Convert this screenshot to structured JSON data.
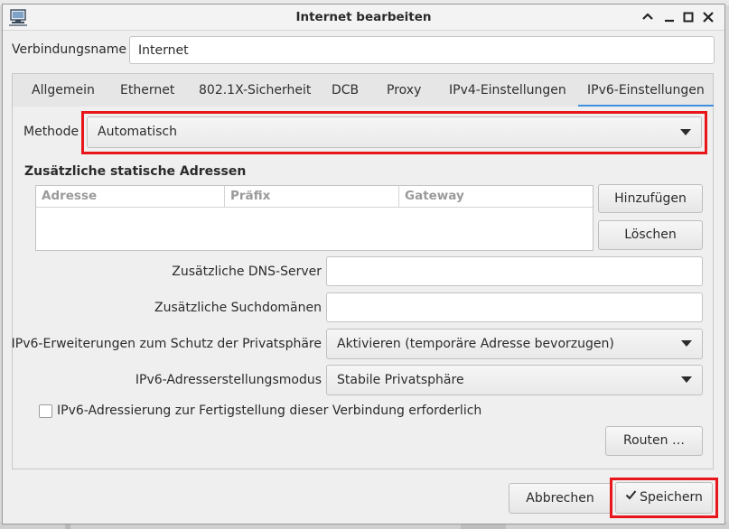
{
  "window": {
    "title": "Internet bearbeiten",
    "controls": [
      "chevron-up",
      "minimize",
      "maximize",
      "close"
    ]
  },
  "connection_name": {
    "label": "Verbindungsname",
    "value": "Internet"
  },
  "tabs": [
    {
      "label": "Allgemein",
      "active": false
    },
    {
      "label": "Ethernet",
      "active": false
    },
    {
      "label": "802.1X-Sicherheit",
      "active": false
    },
    {
      "label": "DCB",
      "active": false
    },
    {
      "label": "Proxy",
      "active": false
    },
    {
      "label": "IPv4-Einstellungen",
      "active": false
    },
    {
      "label": "IPv6-Einstellungen",
      "active": true
    }
  ],
  "ipv6": {
    "method": {
      "label": "Methode",
      "value": "Automatisch"
    },
    "static_addresses": {
      "heading": "Zusätzliche statische Adressen",
      "columns": [
        "Adresse",
        "Präfix",
        "Gateway"
      ],
      "rows": [],
      "add_label": "Hinzufügen",
      "delete_label": "Löschen"
    },
    "dns": {
      "label": "Zusätzliche DNS-Server",
      "value": ""
    },
    "search_domains": {
      "label": "Zusätzliche Suchdomänen",
      "value": ""
    },
    "privacy": {
      "label": "IPv6-Erweiterungen zum Schutz der Privatsphäre",
      "value": "Aktivieren (temporäre Adresse bevorzugen)"
    },
    "addr_gen_mode": {
      "label": "IPv6-Adresserstellungsmodus",
      "value": "Stabile Privatsphäre"
    },
    "require_ipv6": {
      "label": "IPv6-Adressierung zur Fertigstellung dieser Verbindung erforderlich",
      "checked": false
    },
    "routes_label": "Routen …"
  },
  "footer": {
    "cancel_label": "Abbrechen",
    "save_label": "Speichern"
  },
  "colors": {
    "accent": "#3f8fe0",
    "highlight": "#e8151a"
  }
}
